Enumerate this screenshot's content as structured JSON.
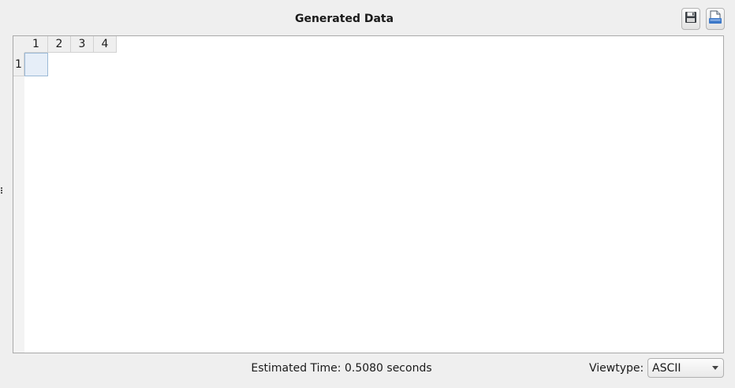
{
  "header": {
    "title": "Generated Data",
    "save_icon": "save-icon",
    "export_icon": "export-icon"
  },
  "table": {
    "column_headers": [
      "1",
      "2",
      "3",
      "4"
    ],
    "row_headers": [
      "1"
    ],
    "selected_cell_color": "#e6eef8"
  },
  "footer": {
    "estimated_time": "Estimated Time: 0.5080 seconds",
    "viewtype_label": "Viewtype:",
    "viewtype_value": "ASCII"
  }
}
